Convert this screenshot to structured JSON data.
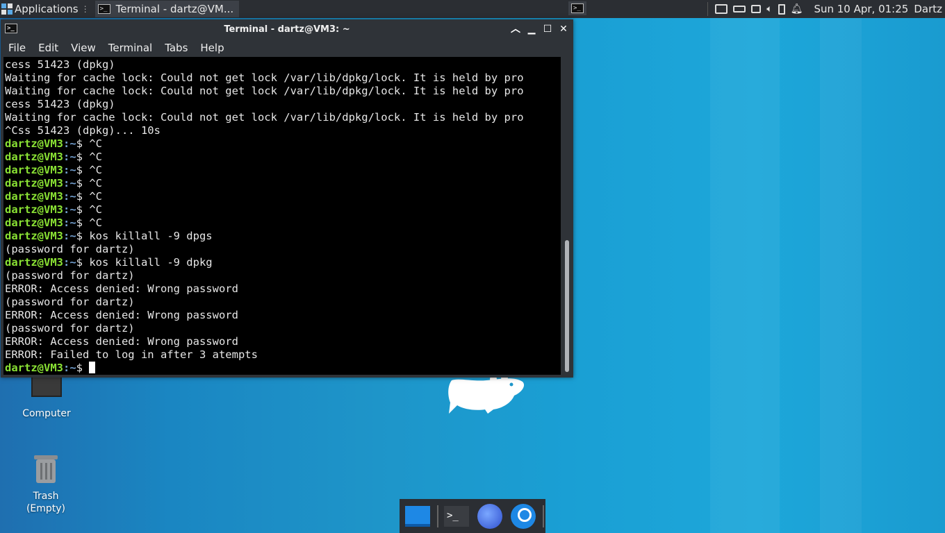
{
  "top_panel": {
    "applications_label": "Applications",
    "task_label": "Terminal - dartz@VM...",
    "clock": "Sun 10 Apr, 01:25",
    "user": "Dartz"
  },
  "window": {
    "title": "Terminal - dartz@VM3: ~",
    "menu": [
      "File",
      "Edit",
      "View",
      "Terminal",
      "Tabs",
      "Help"
    ]
  },
  "terminal": {
    "prompt_user": "dartz@VM3",
    "prompt_path": ":~",
    "lines": [
      {
        "text": "cess 51423 (dpkg)"
      },
      {
        "text": "Waiting for cache lock: Could not get lock /var/lib/dpkg/lock. It is held by pro"
      },
      {
        "text": "Waiting for cache lock: Could not get lock /var/lib/dpkg/lock. It is held by pro"
      },
      {
        "text": "cess 51423 (dpkg)"
      },
      {
        "text": "Waiting for cache lock: Could not get lock /var/lib/dpkg/lock. It is held by pro"
      },
      {
        "text": "^Css 51423 (dpkg)... 10s"
      },
      {
        "prompt": true,
        "cmd": "$ ^C"
      },
      {
        "prompt": true,
        "cmd": "$ ^C"
      },
      {
        "prompt": true,
        "cmd": "$ ^C"
      },
      {
        "prompt": true,
        "cmd": "$ ^C"
      },
      {
        "prompt": true,
        "cmd": "$ ^C"
      },
      {
        "prompt": true,
        "cmd": "$ ^C"
      },
      {
        "prompt": true,
        "cmd": "$ ^C"
      },
      {
        "prompt": true,
        "cmd": "$ kos killall -9 dpgs"
      },
      {
        "text": "(password for dartz)"
      },
      {
        "prompt": true,
        "cmd": "$ kos killall -9 dpkg"
      },
      {
        "text": "(password for dartz)"
      },
      {
        "text": "ERROR: Access denied: Wrong password"
      },
      {
        "text": "(password for dartz)"
      },
      {
        "text": "ERROR: Access denied: Wrong password"
      },
      {
        "text": "(password for dartz)"
      },
      {
        "text": "ERROR: Access denied: Wrong password"
      },
      {
        "text": "ERROR: Failed to log in after 3 atempts"
      },
      {
        "prompt": true,
        "cmd": "$ ",
        "cursor": true
      }
    ]
  },
  "desktop": {
    "icons": [
      {
        "label": "Computer",
        "icon": "computer-icon"
      },
      {
        "label": "Trash\n(Empty)",
        "icon": "trash-icon"
      }
    ]
  },
  "dock": {
    "items": [
      "show-desktop-icon",
      "terminal-icon",
      "browser-icon",
      "search-icon"
    ]
  },
  "colors": {
    "prompt_user": "#8ae234",
    "prompt_path": "#729fcf",
    "terminal_bg": "#000000",
    "panel_bg": "#2b2e33"
  }
}
